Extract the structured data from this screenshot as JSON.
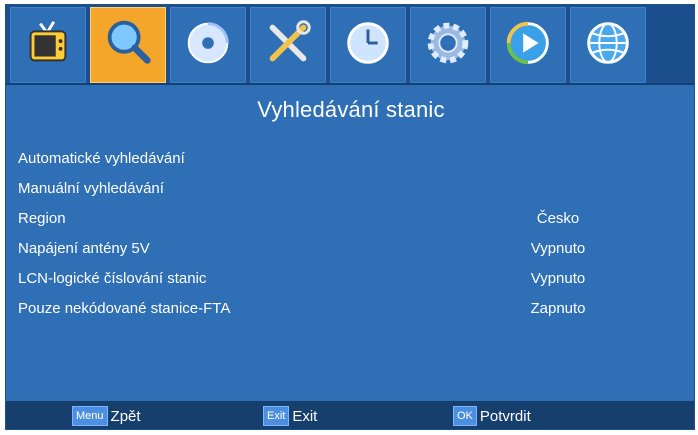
{
  "header": {
    "tabs": [
      {
        "icon": "tv-icon",
        "active": false
      },
      {
        "icon": "search-icon",
        "active": true
      },
      {
        "icon": "disc-icon",
        "active": false
      },
      {
        "icon": "tools-icon",
        "active": false
      },
      {
        "icon": "clock-icon",
        "active": false
      },
      {
        "icon": "gear-icon",
        "active": false
      },
      {
        "icon": "play-icon",
        "active": false
      },
      {
        "icon": "globe-icon",
        "active": false
      }
    ]
  },
  "page": {
    "title": "Vyhledávání stanic"
  },
  "menu": {
    "items": [
      {
        "label": "Automatické vyhledávání",
        "value": ""
      },
      {
        "label": "Manuální vyhledávání",
        "value": ""
      },
      {
        "label": "Region",
        "value": "Česko"
      },
      {
        "label": "Napájení antény 5V",
        "value": "Vypnuto"
      },
      {
        "label": "LCN-logické číslování stanic",
        "value": "Vypnuto"
      },
      {
        "label": "Pouze nekódované stanice-FTA",
        "value": "Zapnuto"
      }
    ]
  },
  "footer": {
    "hints": [
      {
        "key": "Menu",
        "label": "Zpět"
      },
      {
        "key": "Exit",
        "label": "Exit"
      },
      {
        "key": "OK",
        "label": "Potvrdit"
      }
    ]
  },
  "colors": {
    "background": "#2f6fb6",
    "active_tab": "#f4a62a",
    "footer": "#173f6d"
  }
}
